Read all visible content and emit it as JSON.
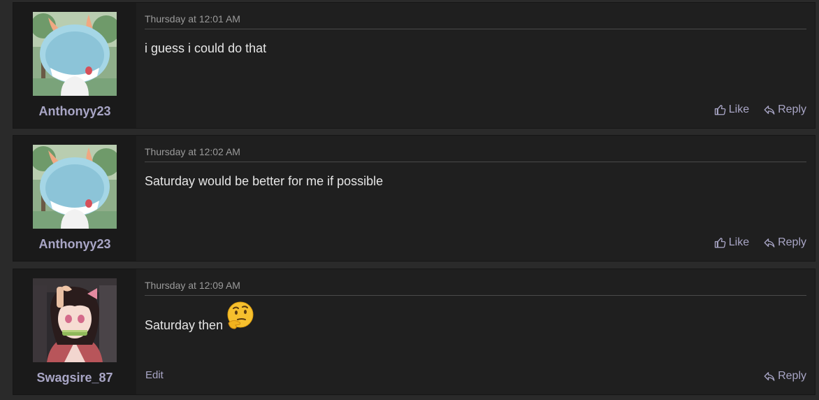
{
  "posts": [
    {
      "username": "Anthonyy23",
      "avatar_icon": "ralts-avatar",
      "date": "Thursday at 12:01 AM",
      "message": "i guess i could do that",
      "like_label": "Like",
      "reply_label": "Reply"
    },
    {
      "username": "Anthonyy23",
      "avatar_icon": "ralts-avatar",
      "date": "Thursday at 12:02 AM",
      "message": "Saturday would be better for me if possible",
      "like_label": "Like",
      "reply_label": "Reply"
    },
    {
      "username": "Swagsire_87",
      "avatar_icon": "anime-girl-avatar",
      "date": "Thursday at 12:09 AM",
      "message": "Saturday then",
      "emoji": "thinking-face-emoji",
      "edit_label": "Edit",
      "reply_label": "Reply"
    }
  ],
  "colors": {
    "page_bg": "#2a2a2a",
    "post_bg": "#1f1f1f",
    "user_panel_bg": "#1a1a1a",
    "username": "#a9a6c6",
    "link": "#a9a6c6",
    "text": "#e6e6e6",
    "date": "#9b9b9b"
  }
}
